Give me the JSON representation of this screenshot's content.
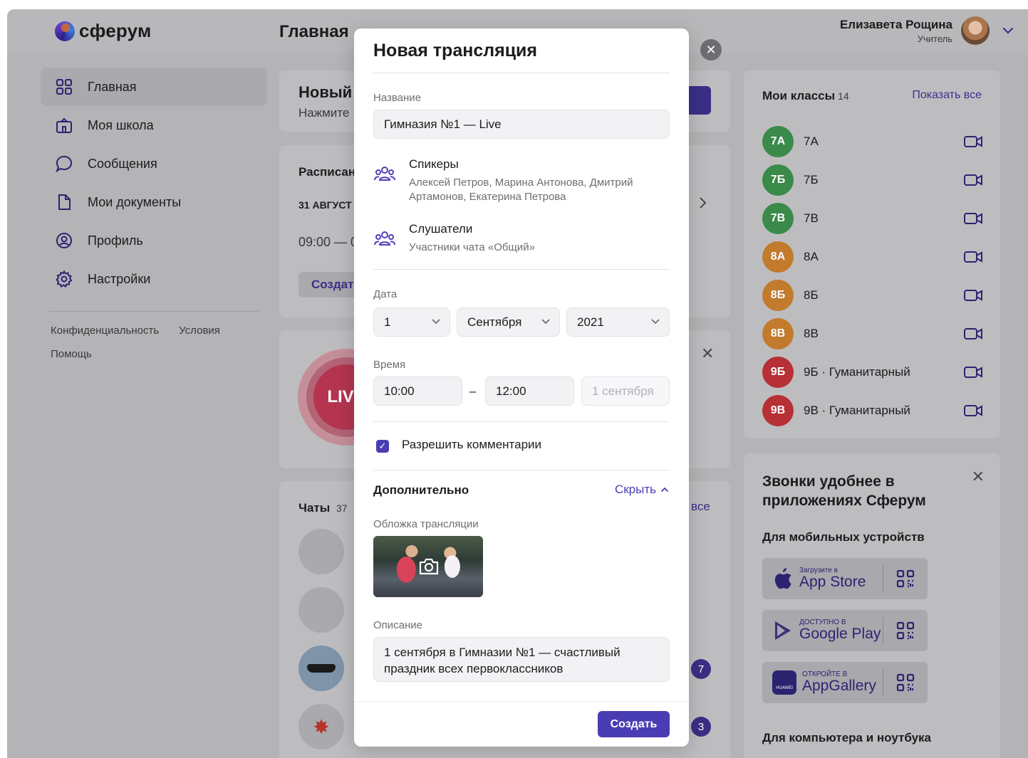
{
  "app": {
    "logo_text": "сферум",
    "page_title": "Главная"
  },
  "user": {
    "name": "Елизавета Рощина",
    "role": "Учитель"
  },
  "sidebar": {
    "items": [
      {
        "label": "Главная",
        "icon": "grid-icon"
      },
      {
        "label": "Моя школа",
        "icon": "school-icon"
      },
      {
        "label": "Сообщения",
        "icon": "chat-icon"
      },
      {
        "label": "Мои документы",
        "icon": "document-icon"
      },
      {
        "label": "Профиль",
        "icon": "profile-icon"
      },
      {
        "label": "Настройки",
        "icon": "gear-icon"
      }
    ],
    "links": {
      "privacy": "Конфиденциальность",
      "terms": "Условия",
      "help": "Помощь"
    }
  },
  "main": {
    "new_card": {
      "title": "Новый",
      "subtitle": "Нажмите"
    },
    "schedule": {
      "title": "Расписан",
      "date": "31 АВГУСТ",
      "time": "09:00 — 0",
      "button": "Создат"
    },
    "live_label": "LIVE",
    "chats": {
      "title": "Чаты",
      "count": "37",
      "all_link": "все",
      "badges": [
        "7",
        "3"
      ]
    }
  },
  "classes": {
    "title": "Мои классы",
    "count": "14",
    "show_all": "Показать все",
    "items": [
      {
        "badge": "7А",
        "name": "7А",
        "color": "#3a8a4a"
      },
      {
        "badge": "7Б",
        "name": "7Б",
        "color": "#3a8a4a"
      },
      {
        "badge": "7В",
        "name": "7В",
        "color": "#3a8a4a"
      },
      {
        "badge": "8А",
        "name": "8А",
        "color": "#c27a2c"
      },
      {
        "badge": "8Б",
        "name": "8Б",
        "color": "#c27a2c"
      },
      {
        "badge": "8В",
        "name": "8В",
        "color": "#c27a2c"
      },
      {
        "badge": "9Б",
        "name": "9Б · Гуманитарный",
        "color": "#b63036"
      },
      {
        "badge": "9В",
        "name": "9В · Гуманитарный",
        "color": "#b63036"
      }
    ]
  },
  "promo": {
    "title": "Звонки удобнее в приложениях Сферум",
    "mobile_heading": "Для мобильных устройств",
    "desktop_heading": "Для компьютера и ноутбука",
    "stores": [
      {
        "small": "Загрузите в",
        "big": "App Store",
        "icon": "apple-icon"
      },
      {
        "small": "ДОСТУПНО В",
        "big": "Google Play",
        "icon": "google-play-icon"
      },
      {
        "small": "ОТКРОЙТЕ В",
        "big": "AppGallery",
        "icon": "huawei-icon",
        "logo_text": "HUAWEI"
      }
    ]
  },
  "modal": {
    "title": "Новая трансляция",
    "name_label": "Название",
    "name_value": "Гимназия №1 — Live",
    "speakers_title": "Спикеры",
    "speakers_list": "Алексей Петров, Марина Антонова, Дмитрий Артамонов, Екатерина Петрова",
    "listeners_title": "Слушатели",
    "listeners_sub": "Участники чата «Общий»",
    "date_label": "Дата",
    "day": "1",
    "month": "Сентября",
    "year": "2021",
    "time_label": "Время",
    "time_from": "10:00",
    "time_dash": "–",
    "time_to": "12:00",
    "end_date": "1 сентября",
    "allow_comments": "Разрешить комментарии",
    "advanced_title": "Дополнительно",
    "hide_label": "Скрыть",
    "cover_label": "Обложка трансляции",
    "description_label": "Описание",
    "description_value": "1 сентября в Гимназии №1 — счастливый праздник всех первоклассников",
    "create_button": "Создать"
  }
}
